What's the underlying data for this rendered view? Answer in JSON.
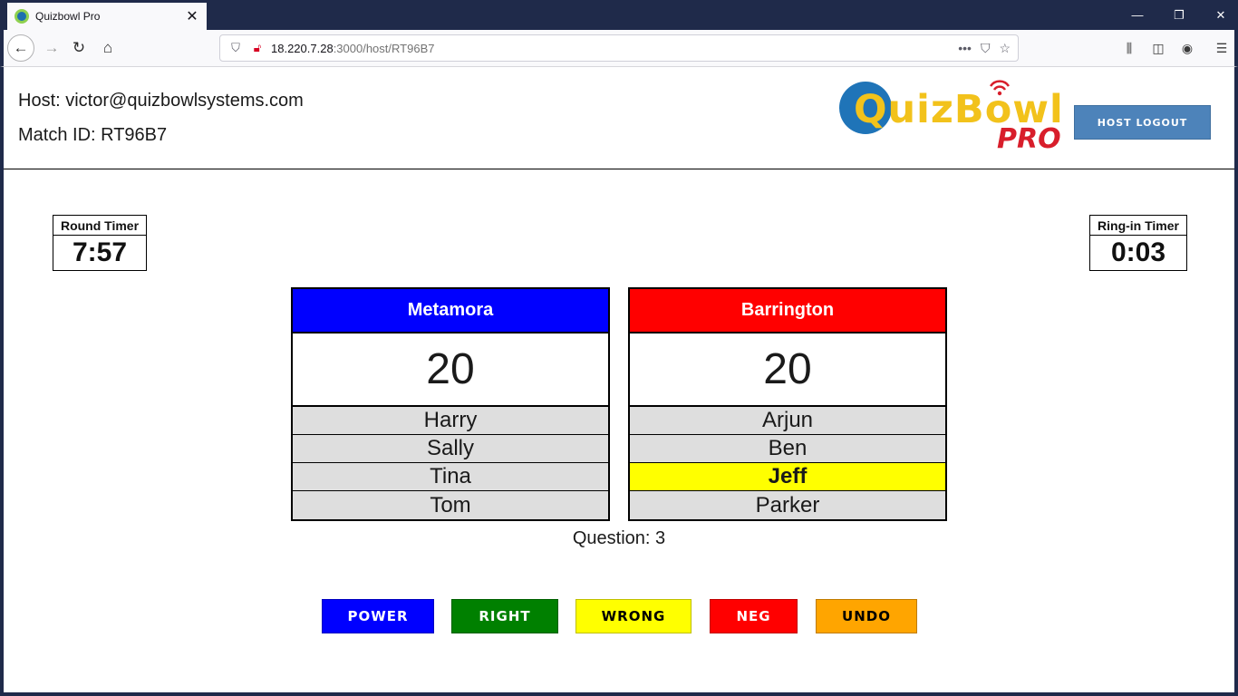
{
  "browser": {
    "tab_title": "Quizbowl Pro",
    "url_host": "18.220.7.28",
    "url_rest": ":3000/host/RT96B7",
    "icons": {
      "back": "back-arrow-icon",
      "forward": "forward-arrow-icon",
      "reload": "reload-icon",
      "home": "home-icon",
      "more": "more-icon",
      "pocket": "pocket-icon",
      "bookmark": "star-icon",
      "library": "library-icon",
      "sidebar": "sidebar-icon",
      "account": "account-icon",
      "menu": "hamburger-menu-icon"
    }
  },
  "header": {
    "host_label": "Host: victor@quizbowlsystems.com",
    "match_label": "Match ID: RT96B7",
    "logo_word": "QuizBowl",
    "logo_pro": "PRO",
    "logout_label": "HOST LOGOUT"
  },
  "timers": {
    "round": {
      "label": "Round Timer",
      "value": "7:57"
    },
    "ringin": {
      "label": "Ring-in Timer",
      "value": "0:03"
    }
  },
  "teams": [
    {
      "name": "Metamora",
      "color": "#0000ff",
      "score": "20",
      "players": [
        "Harry",
        "Sally",
        "Tina",
        "Tom"
      ],
      "active_player": null
    },
    {
      "name": "Barrington",
      "color": "#ff0000",
      "score": "20",
      "players": [
        "Arjun",
        "Ben",
        "Jeff",
        "Parker"
      ],
      "active_player": "Jeff"
    }
  ],
  "question_label": "Question: 3",
  "actions": {
    "power": {
      "label": "POWER",
      "bg": "#0000ff",
      "fg": "#ffffff"
    },
    "right": {
      "label": "RIGHT",
      "bg": "#008000",
      "fg": "#ffffff"
    },
    "wrong": {
      "label": "WRONG",
      "bg": "#ffff00",
      "fg": "#000000"
    },
    "neg": {
      "label": "NEG",
      "bg": "#ff0000",
      "fg": "#ffffff"
    },
    "undo": {
      "label": "UNDO",
      "bg": "#ffa500",
      "fg": "#000000"
    }
  }
}
